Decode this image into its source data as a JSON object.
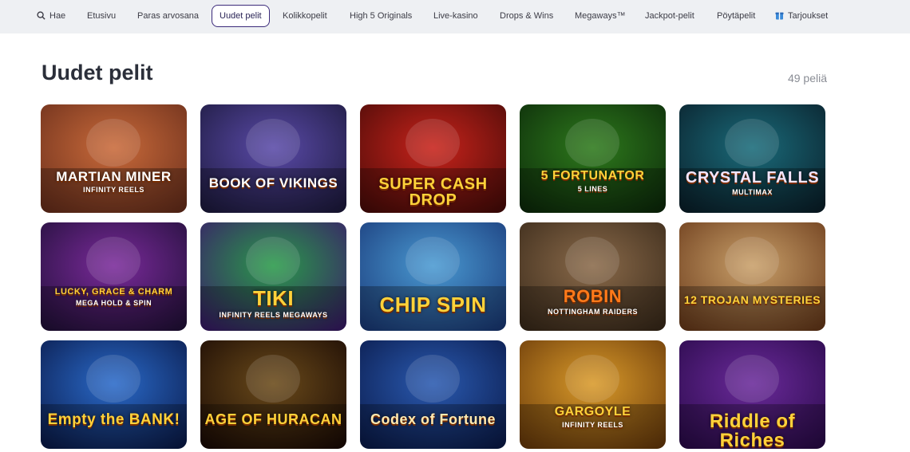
{
  "nav": {
    "items": [
      {
        "label": "Hae",
        "icon": "search-icon",
        "active": false
      },
      {
        "label": "Etusivu",
        "active": false
      },
      {
        "label": "Paras arvosana",
        "active": false
      },
      {
        "label": "Uudet pelit",
        "active": true
      },
      {
        "label": "Kolikkopelit",
        "active": false
      },
      {
        "label": "High 5 Originals",
        "active": false
      },
      {
        "label": "Live-kasino",
        "active": false
      },
      {
        "label": "Drops & Wins",
        "active": false
      },
      {
        "label": "Megaways™",
        "active": false
      },
      {
        "label": "Jackpot-pelit",
        "active": false
      },
      {
        "label": "Pöytäpelit",
        "active": false
      },
      {
        "label": "Tarjoukset",
        "icon": "gift-icon",
        "active": false
      }
    ]
  },
  "section": {
    "title": "Uudet pelit",
    "count": "49 peliä"
  },
  "games": [
    {
      "name": "MARTIAN MINER",
      "subtitle": "INFINITY REELS",
      "colors": [
        "#c96a3a",
        "#6b2f1c"
      ],
      "text_color": "#ffffff"
    },
    {
      "name": "BOOK OF VIKINGS",
      "subtitle": "",
      "colors": [
        "#5a4aa8",
        "#1d1a3e"
      ],
      "text_color": "#ffffff"
    },
    {
      "name": "SUPER CASH DROP",
      "subtitle": "",
      "colors": [
        "#c8231b",
        "#4a0b08"
      ],
      "text_color": "#ffd23a"
    },
    {
      "name": "5 FORTUNATOR",
      "subtitle": "5 LINES",
      "colors": [
        "#2e7a1c",
        "#0c2a0a"
      ],
      "text_color": "#ffd23a"
    },
    {
      "name": "CRYSTAL FALLS",
      "subtitle": "MULTIMAX",
      "colors": [
        "#1a6b7a",
        "#0a1f2a"
      ],
      "text_color": "#f2e6ff"
    },
    {
      "name": "LUCKY, GRACE & CHARM",
      "subtitle": "MEGA HOLD & SPIN",
      "colors": [
        "#7a2a9a",
        "#22103a"
      ],
      "text_color": "#ffd23a"
    },
    {
      "name": "TIKI",
      "subtitle": "INFINITY REELS MEGAWAYS",
      "colors": [
        "#2a9a4a",
        "#3a1a6a"
      ],
      "text_color": "#ffd23a"
    },
    {
      "name": "CHIP SPIN",
      "subtitle": "",
      "colors": [
        "#4a9ad2",
        "#1a3a7a"
      ],
      "text_color": "#ffd23a"
    },
    {
      "name": "ROBIN",
      "subtitle": "NOTTINGHAM RAIDERS",
      "colors": [
        "#8a6a4a",
        "#3a2a1a"
      ],
      "text_color": "#ff7a1a"
    },
    {
      "name": "12 TROJAN MYSTERIES",
      "subtitle": "",
      "colors": [
        "#c9a06a",
        "#6a3a1a"
      ],
      "text_color": "#ffd23a"
    },
    {
      "name": "Empty the BANK!",
      "subtitle": "",
      "colors": [
        "#2a6ac9",
        "#0a1a4a"
      ],
      "text_color": "#ffd23a"
    },
    {
      "name": "AGE OF HURACAN",
      "subtitle": "",
      "colors": [
        "#6a4a1a",
        "#1a0a04"
      ],
      "text_color": "#ffd23a"
    },
    {
      "name": "Codex of Fortune",
      "subtitle": "",
      "colors": [
        "#2a5ab0",
        "#0a1a4a"
      ],
      "text_color": "#ffe9b0"
    },
    {
      "name": "GARGOYLE",
      "subtitle": "INFINITY REELS",
      "colors": [
        "#d99a2a",
        "#6a3a0a"
      ],
      "text_color": "#ffd23a"
    },
    {
      "name": "Riddle of Riches",
      "subtitle": "",
      "colors": [
        "#6a2a9a",
        "#2a0a4a"
      ],
      "text_color": "#ffd23a"
    }
  ]
}
